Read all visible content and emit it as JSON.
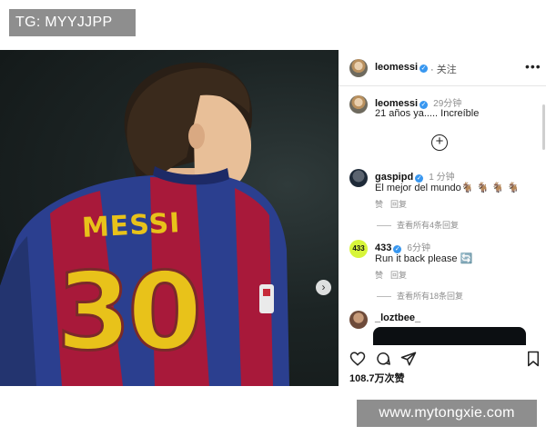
{
  "tag_text": "TG: MYYJJPP",
  "watermark_text": "www.mytongxie.com",
  "photo": {
    "jersey_name": "MESSI",
    "jersey_number": "30",
    "next_icon": "chevron-right-icon"
  },
  "post": {
    "username": "leomessi",
    "follow_label": "· 关注",
    "more_icon": "more-horizontal-icon",
    "caption_user": "leomessi",
    "caption_time": "29分钟",
    "caption_text": "21 años ya..... Increíble",
    "load_more_icon": "plus-circle-icon"
  },
  "comments": [
    {
      "username": "gaspipd",
      "time": "1 分钟",
      "text": "El mejor del mundo🐐 🐐 🐐 🐐",
      "like": "赞",
      "reply": "回复",
      "view_replies": "查看所有4条回复"
    },
    {
      "username": "433",
      "avatar_text": "433",
      "time": "6分钟",
      "text": "Run it back please 🔄",
      "like": "赞",
      "reply": "回复",
      "view_replies": "查看所有18条回复"
    },
    {
      "username": "_loztbee_"
    }
  ],
  "actions": {
    "icons": [
      "heart-icon",
      "comment-icon",
      "share-icon",
      "bookmark-icon"
    ],
    "likes": "108.7万次赞"
  },
  "colors": {
    "verified": "#3897f0",
    "badge_bg": "#8e8e8e",
    "jersey_blue": "#2b3f8f",
    "jersey_red": "#a8193a",
    "number_yellow": "#e8c21a"
  }
}
